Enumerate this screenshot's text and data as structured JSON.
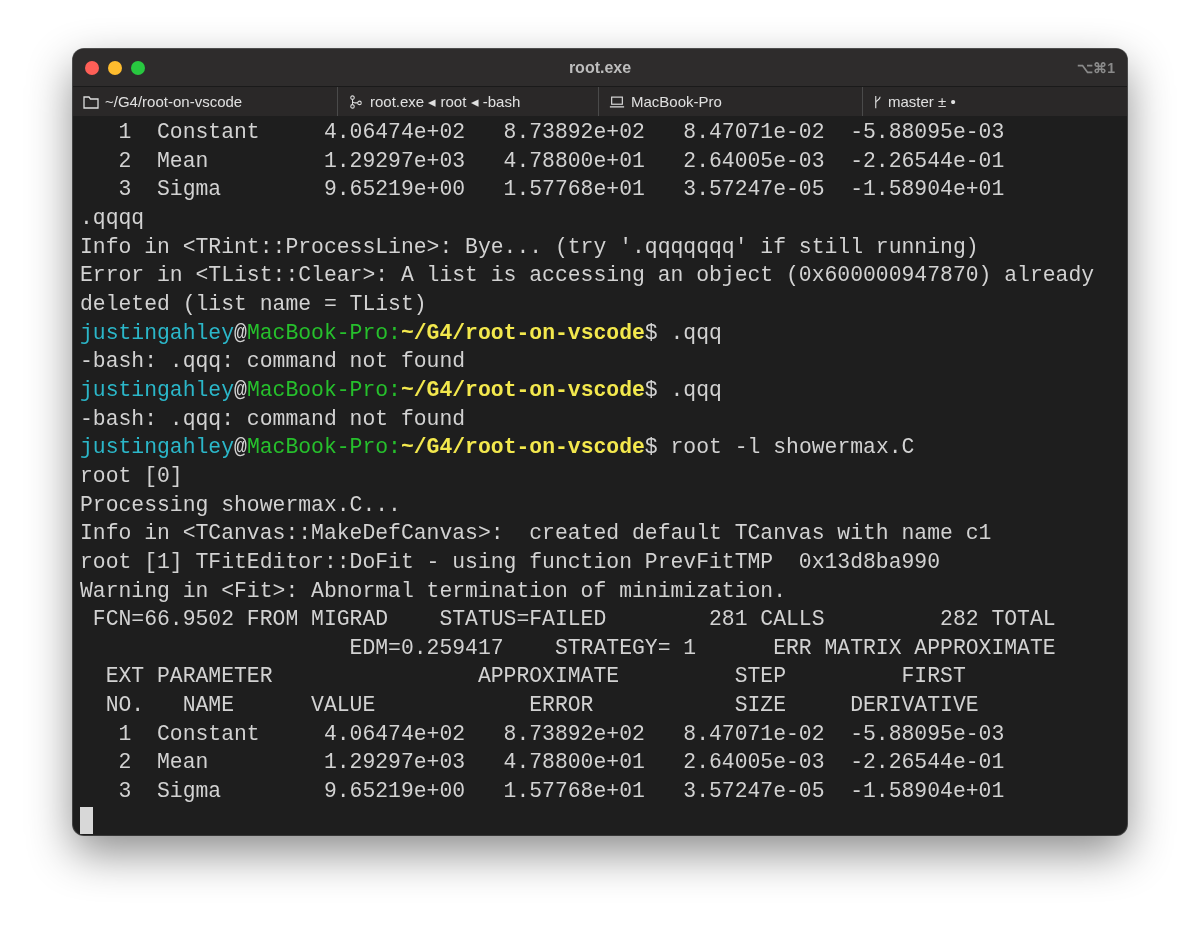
{
  "window": {
    "title": "root.exe",
    "shortcut": "⌥⌘1"
  },
  "tabs": [
    {
      "kind": "folder",
      "label": "~/G4/root-on-vscode"
    },
    {
      "kind": "process",
      "label": "root.exe ◂ root ◂ -bash"
    },
    {
      "kind": "host",
      "label": "MacBook-Pro"
    },
    {
      "kind": "branch",
      "label": "master ± •"
    }
  ],
  "terminal": {
    "lines": [
      {
        "kind": "text",
        "text": "   1  Constant     4.06474e+02   8.73892e+02   8.47071e-02  -5.88095e-03"
      },
      {
        "kind": "text",
        "text": "   2  Mean         1.29297e+03   4.78800e+01   2.64005e-03  -2.26544e-01"
      },
      {
        "kind": "text",
        "text": "   3  Sigma        9.65219e+00   1.57768e+01   3.57247e-05  -1.58904e+01"
      },
      {
        "kind": "text",
        "text": ".qqqq"
      },
      {
        "kind": "text",
        "text": "Info in <TRint::ProcessLine>: Bye... (try '.qqqqqqq' if still running)"
      },
      {
        "kind": "text",
        "text": "Error in <TList::Clear>: A list is accessing an object (0x600000947870) already"
      },
      {
        "kind": "text",
        "text": "deleted (list name = TList)"
      },
      {
        "kind": "prompt",
        "segments": [
          {
            "kind": "user",
            "text": "justingahley"
          },
          {
            "kind": "plain",
            "text": "@"
          },
          {
            "kind": "host",
            "text": "MacBook-Pro:"
          },
          {
            "kind": "path",
            "text": "~/G4/root-on-vscode"
          },
          {
            "kind": "plain",
            "text": "$ .qqq"
          }
        ]
      },
      {
        "kind": "text",
        "text": "-bash: .qqq: command not found"
      },
      {
        "kind": "prompt",
        "segments": [
          {
            "kind": "user",
            "text": "justingahley"
          },
          {
            "kind": "plain",
            "text": "@"
          },
          {
            "kind": "host",
            "text": "MacBook-Pro:"
          },
          {
            "kind": "path",
            "text": "~/G4/root-on-vscode"
          },
          {
            "kind": "plain",
            "text": "$ .qqq"
          }
        ]
      },
      {
        "kind": "text",
        "text": "-bash: .qqq: command not found"
      },
      {
        "kind": "prompt",
        "segments": [
          {
            "kind": "user",
            "text": "justingahley"
          },
          {
            "kind": "plain",
            "text": "@"
          },
          {
            "kind": "host",
            "text": "MacBook-Pro:"
          },
          {
            "kind": "path",
            "text": "~/G4/root-on-vscode"
          },
          {
            "kind": "plain",
            "text": "$ root -l showermax.C"
          }
        ]
      },
      {
        "kind": "text",
        "text": "root [0]"
      },
      {
        "kind": "text",
        "text": "Processing showermax.C..."
      },
      {
        "kind": "text",
        "text": "Info in <TCanvas::MakeDefCanvas>:  created default TCanvas with name c1"
      },
      {
        "kind": "text",
        "text": "root [1] TFitEditor::DoFit - using function PrevFitTMP  0x13d8ba990"
      },
      {
        "kind": "text",
        "text": "Warning in <Fit>: Abnormal termination of minimization."
      },
      {
        "kind": "text",
        "text": " FCN=66.9502 FROM MIGRAD    STATUS=FAILED        281 CALLS         282 TOTAL"
      },
      {
        "kind": "text",
        "text": "                     EDM=0.259417    STRATEGY= 1      ERR MATRIX APPROXIMATE"
      },
      {
        "kind": "text",
        "text": "  EXT PARAMETER                APPROXIMATE         STEP         FIRST"
      },
      {
        "kind": "text",
        "text": "  NO.   NAME      VALUE            ERROR           SIZE     DERIVATIVE"
      },
      {
        "kind": "text",
        "text": "   1  Constant     4.06474e+02   8.73892e+02   8.47071e-02  -5.88095e-03"
      },
      {
        "kind": "text",
        "text": "   2  Mean         1.29297e+03   4.78800e+01   2.64005e-03  -2.26544e-01"
      },
      {
        "kind": "text",
        "text": "   3  Sigma        9.65219e+00   1.57768e+01   3.57247e-05  -1.58904e+01"
      }
    ]
  }
}
